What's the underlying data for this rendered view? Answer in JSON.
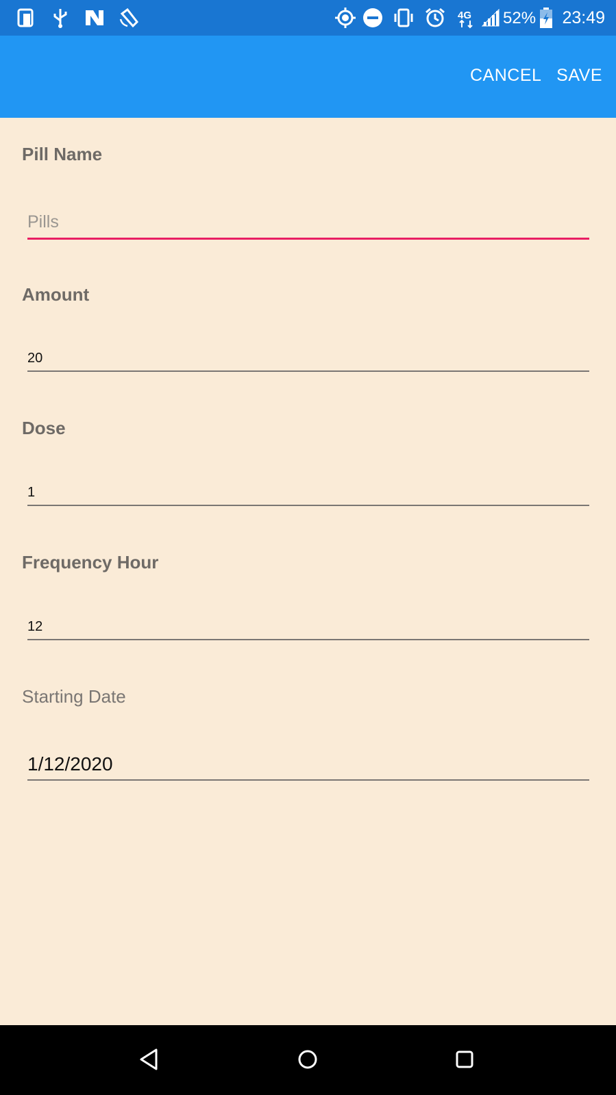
{
  "status_bar": {
    "icons": [
      "screenshot-icon",
      "usb-icon",
      "n-app-icon",
      "satellite-icon",
      "location-icon",
      "do-not-disturb-icon",
      "vibrate-icon",
      "alarm-icon",
      "4g-icon",
      "signal-icon",
      "battery-icon"
    ],
    "battery_percent": "52%",
    "time": "23:49"
  },
  "app_bar": {
    "cancel_label": "CANCEL",
    "save_label": "SAVE"
  },
  "form": {
    "pill_name": {
      "label": "Pill Name",
      "value": "",
      "placeholder": "Pills"
    },
    "amount": {
      "label": "Amount",
      "value": "20"
    },
    "dose": {
      "label": "Dose",
      "value": "1"
    },
    "frequency_hour": {
      "label": "Frequency Hour",
      "value": "12"
    },
    "starting_date": {
      "label": "Starting Date",
      "value": "1/12/2020"
    }
  },
  "colors": {
    "status_bar": "#1976D2",
    "app_bar": "#2196F3",
    "background": "#FAEBD7",
    "focus_underline": "#E91E63"
  }
}
